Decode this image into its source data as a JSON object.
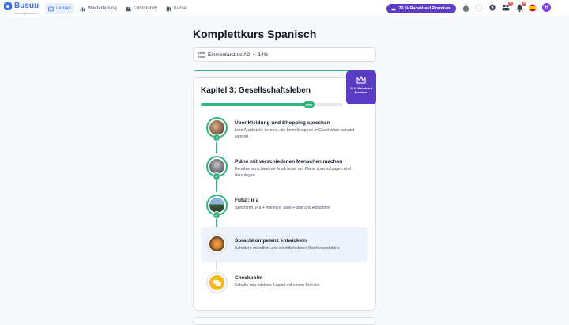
{
  "header": {
    "logo_text": "Busuu",
    "logo_sub": "with Chegg Services",
    "nav": [
      {
        "label": "Lernen",
        "icon": "book-icon",
        "active": true
      },
      {
        "label": "Wiederholung",
        "icon": "chart-icon",
        "active": false
      },
      {
        "label": "Community",
        "icon": "people-icon",
        "active": false
      },
      {
        "label": "Kurse",
        "icon": "library-icon",
        "active": false
      }
    ],
    "premium_label": "70 % Rabatt auf Premium",
    "streak_badge": "",
    "friends_badge": "96",
    "notifications_badge": "38",
    "avatar_initial": "H"
  },
  "main": {
    "title": "Komplettkurs Spanisch",
    "level": "Elementarstufe A2",
    "level_progress": "14%"
  },
  "chapter": {
    "title": "Kapitel 3: Gesellschaftsleben",
    "premium_corner": "70 % Rabatt auf Premium",
    "progress_label": "80%",
    "progress": 0.8,
    "lessons": [
      {
        "title": "Über Kleidung und Shopping sprechen",
        "desc": "Lern Ausdrücke kennen, die beim Shoppen in Geschäften benutzt werden",
        "done": true,
        "color": "#8a5a3c"
      },
      {
        "title": "Pläne mit verschiedenen Menschen machen",
        "desc": "Benutze verschiedene Ausdrücke, um Pläne vorzuschlagen und darzulegen",
        "done": true,
        "color": "#5a5a66"
      },
      {
        "title": "Futur: ir a",
        "desc": "Sprich mit „ir a + Infinitivo“ über Pläne und Absichten",
        "done": true,
        "color": "#3f6b8a"
      },
      {
        "title": "Sprachkompetenz entwickeln",
        "desc": "Schildere mündlich und schriftlich deine Wochenendpläne",
        "done": false,
        "color": "#b86a2c"
      },
      {
        "title": "Checkpoint",
        "desc": "Schalte das nächste Kapitel mit einem Test frei.",
        "done": false,
        "color": "#f2b21b"
      }
    ]
  }
}
